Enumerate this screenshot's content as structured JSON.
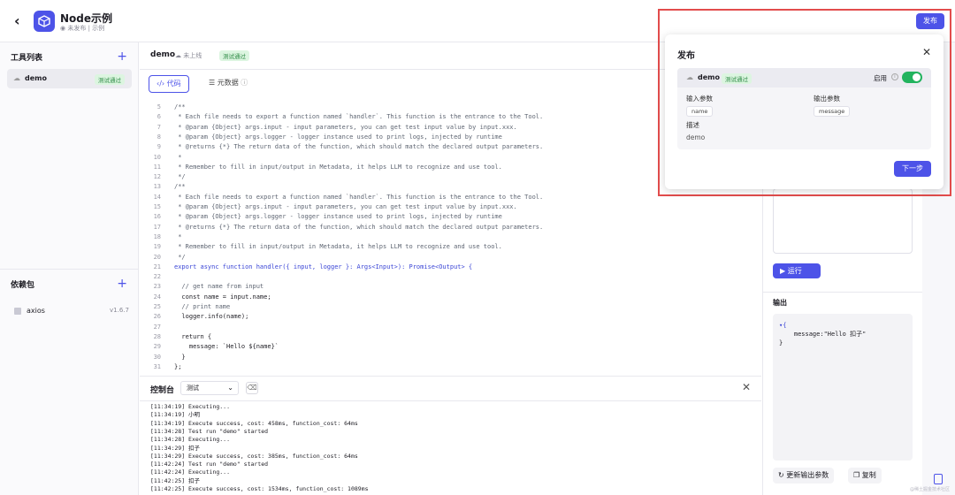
{
  "header": {
    "app_name": "Node示例",
    "status": "未发布",
    "separator": "|",
    "category": "示例",
    "publish_label": "发布"
  },
  "sidebar": {
    "tools_title": "工具列表",
    "tool_name": "demo",
    "tool_badge": "测试通过",
    "deps_title": "依赖包",
    "dep_name": "axios",
    "dep_version": "v1.6.7"
  },
  "editor": {
    "tool_name": "demo",
    "upload_status": "未上线",
    "badge": "测试通过",
    "tab_code": "代码",
    "tab_meta": "元数据",
    "lines": [
      {
        "n": "5",
        "t": "/**",
        "c": "cm"
      },
      {
        "n": "6",
        "t": " * Each file needs to export a function named `handler`. This function is the entrance to the Tool.",
        "c": "cm"
      },
      {
        "n": "7",
        "t": " * @param {Object} args.input - input parameters, you can get test input value by input.xxx.",
        "c": "cm"
      },
      {
        "n": "8",
        "t": " * @param {Object} args.logger - logger instance used to print logs, injected by runtime",
        "c": "cm"
      },
      {
        "n": "9",
        "t": " * @returns {*} The return data of the function, which should match the declared output parameters.",
        "c": "cm"
      },
      {
        "n": "10",
        "t": " *",
        "c": "cm"
      },
      {
        "n": "11",
        "t": " * Remember to fill in input/output in Metadata, it helps LLM to recognize and use tool.",
        "c": "cm"
      },
      {
        "n": "12",
        "t": " */",
        "c": "cm"
      },
      {
        "n": "13",
        "t": "/**",
        "c": "cm"
      },
      {
        "n": "14",
        "t": " * Each file needs to export a function named `handler`. This function is the entrance to the Tool.",
        "c": "cm"
      },
      {
        "n": "15",
        "t": " * @param {Object} args.input - input parameters, you can get test input value by input.xxx.",
        "c": "cm"
      },
      {
        "n": "16",
        "t": " * @param {Object} args.logger - logger instance used to print logs, injected by runtime",
        "c": "cm"
      },
      {
        "n": "17",
        "t": " * @returns {*} The return data of the function, which should match the declared output parameters.",
        "c": "cm"
      },
      {
        "n": "18",
        "t": " *",
        "c": "cm"
      },
      {
        "n": "19",
        "t": " * Remember to fill in input/output in Metadata, it helps LLM to recognize and use tool.",
        "c": "cm"
      },
      {
        "n": "20",
        "t": " */",
        "c": "cm"
      },
      {
        "n": "21",
        "t": "export async function handler({ input, logger }: Args<Input>): Promise<Output> {",
        "c": "kw"
      },
      {
        "n": "22",
        "t": "",
        "c": ""
      },
      {
        "n": "23",
        "t": "  // get name from input",
        "c": "cm"
      },
      {
        "n": "24",
        "t": "  const name = input.name;",
        "c": ""
      },
      {
        "n": "25",
        "t": "  // print name",
        "c": "cm"
      },
      {
        "n": "26",
        "t": "  logger.info(name);",
        "c": ""
      },
      {
        "n": "27",
        "t": "",
        "c": ""
      },
      {
        "n": "28",
        "t": "  return {",
        "c": ""
      },
      {
        "n": "29",
        "t": "    message: `Hello ${name}`",
        "c": ""
      },
      {
        "n": "30",
        "t": "  }",
        "c": ""
      },
      {
        "n": "31",
        "t": "};",
        "c": ""
      }
    ]
  },
  "console": {
    "title": "控制台",
    "selected": "测试",
    "logs": [
      "[11:34:19] Executing...",
      "[11:34:19] 小明",
      "[11:34:19] Execute success, cost: 458ms, function_cost: 64ms",
      "[11:34:28] Test run \"demo\" started",
      "[11:34:28] Executing...",
      "[11:34:29] 扣子",
      "[11:34:29] Execute success, cost: 385ms, function_cost: 64ms",
      "[11:42:24] Test run \"demo\" started",
      "[11:42:24] Executing...",
      "[11:42:25] 扣子",
      "[11:42:25] Execute success, cost: 1534ms, function_cost: 1089ms"
    ]
  },
  "right": {
    "run_label": "运行",
    "output_title": "输出",
    "output_lines": [
      "▾{",
      "    message:\"Hello 扣子\"",
      "}"
    ],
    "update_params_label": "更新输出参数",
    "copy_label": "复制",
    "watermark": "@稀土掘金技术社区"
  },
  "popup": {
    "title": "发布",
    "tool_name": "demo",
    "badge": "测试通过",
    "enable_label": "启用",
    "enabled": true,
    "input_label": "输入参数",
    "input_chip": "name",
    "output_label": "输出参数",
    "output_chip": "message",
    "desc_label": "描述",
    "desc_value": "demo",
    "next_label": "下一步"
  }
}
